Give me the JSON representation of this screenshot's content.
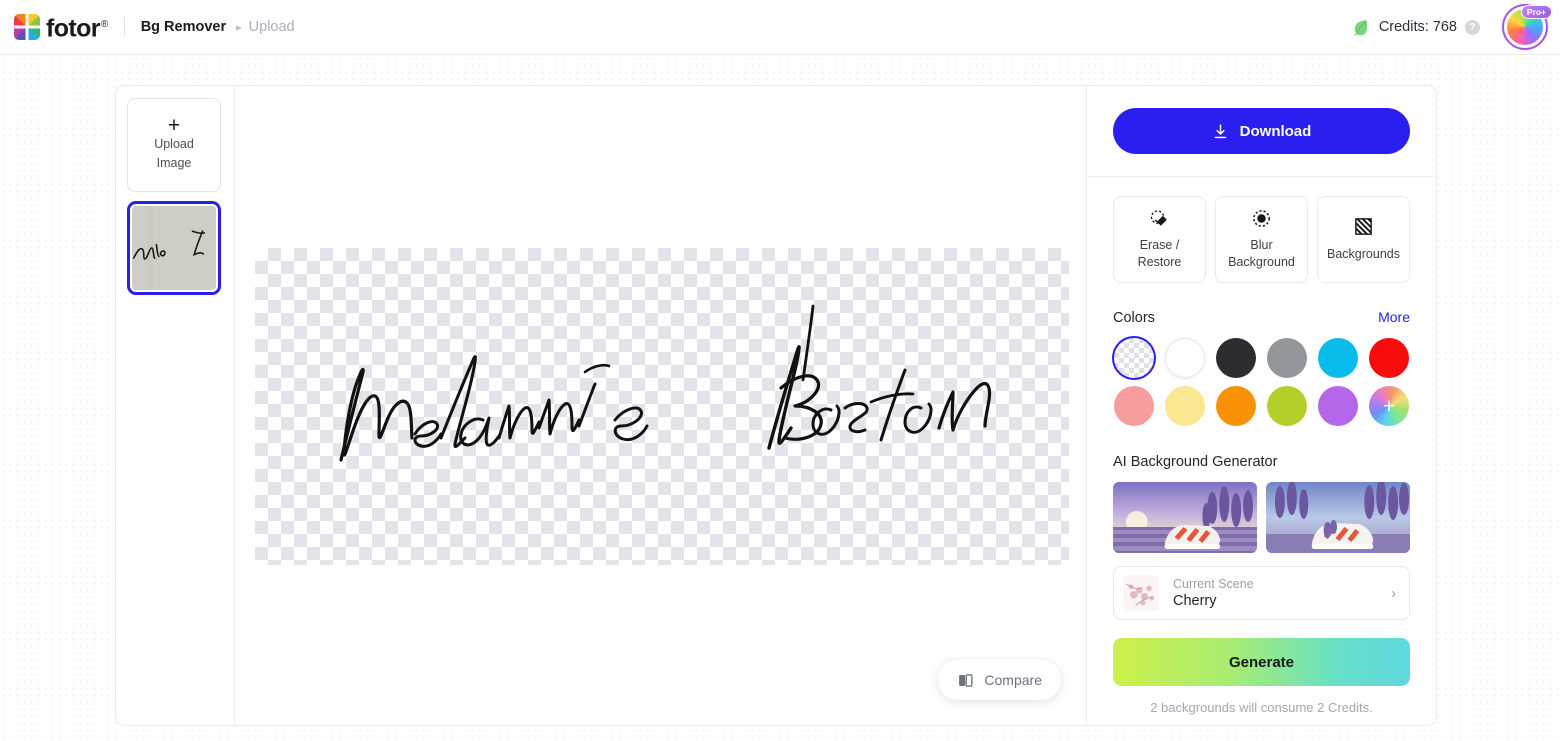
{
  "header": {
    "logo_text": "fotor",
    "logo_registered": "®",
    "logo_icon": "fotor-pinwheel-logo-icon",
    "breadcrumb_main": "Bg Remover",
    "breadcrumb_separator": "▸",
    "breadcrumb_current": "Upload",
    "leaf_icon": "leaf-icon",
    "credits_label": "Credits: 768",
    "help_icon": "?",
    "avatar_badge": "Pro+"
  },
  "thumbnails": {
    "upload_plus": "+",
    "upload_label_line1": "Upload",
    "upload_label_line2": "Image",
    "items": [
      {
        "name": "signature-thumbnail",
        "selected": true
      }
    ]
  },
  "canvas": {
    "compare_label": "Compare",
    "compare_icon": "compare-split-icon",
    "image_alt": "Melannie Boston"
  },
  "panel": {
    "download_label": "Download",
    "download_icon": "download-arrow-icon",
    "download_color": "#2A1FF0",
    "tools": [
      {
        "label_line1": "Erase /",
        "label_line2": "Restore",
        "icon": "eraser-icon",
        "name": "erase-restore"
      },
      {
        "label_line1": "Blur",
        "label_line2": "Background",
        "icon": "blur-icon",
        "name": "blur-background"
      },
      {
        "label_line1": "Backgrounds",
        "label_line2": "",
        "icon": "hatched-square-icon",
        "name": "backgrounds"
      }
    ],
    "colors": {
      "title": "Colors",
      "more_label": "More",
      "more_color": "#2a1ff0",
      "swatches": [
        {
          "name": "transparent",
          "type": "checker",
          "selected": true
        },
        {
          "name": "white",
          "hex": "#FFFFFF",
          "selected": false
        },
        {
          "name": "black",
          "hex": "#2B2D30",
          "selected": false
        },
        {
          "name": "gray",
          "hex": "#93969B",
          "selected": false
        },
        {
          "name": "cyan",
          "hex": "#09BCEB",
          "selected": false
        },
        {
          "name": "red",
          "hex": "#F70B0B",
          "selected": false
        },
        {
          "name": "pink",
          "hex": "#F79D9D",
          "selected": false
        },
        {
          "name": "light-yellow",
          "hex": "#FAE791",
          "selected": false
        },
        {
          "name": "orange",
          "hex": "#F99106",
          "selected": false
        },
        {
          "name": "yellow-green",
          "hex": "#B5CE2A",
          "selected": false
        },
        {
          "name": "purple",
          "hex": "#B567EA",
          "selected": false
        },
        {
          "name": "custom-picker",
          "type": "rainbow",
          "plus": "+",
          "selected": false
        }
      ]
    },
    "ai_background": {
      "title": "AI Background Generator",
      "previews": [
        {
          "name": "preview-sneaker-lavender-sunset"
        },
        {
          "name": "preview-sneaker-lavender-sky"
        }
      ],
      "scene_caption": "Current Scene",
      "scene_name": "Cherry",
      "chevron": "›"
    },
    "generate_label": "Generate",
    "generate_note": "2 backgrounds will consume 2 Credits."
  }
}
